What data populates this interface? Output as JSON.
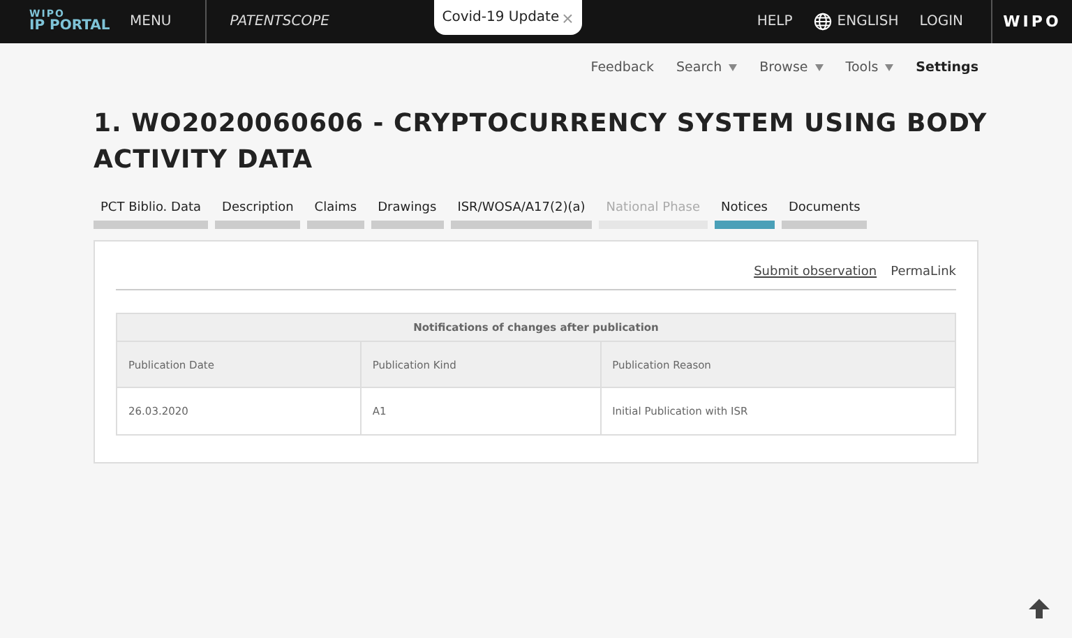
{
  "header": {
    "logo_small": "WIPO",
    "logo_large": "IP PORTAL",
    "menu": "MENU",
    "product": "PATENTSCOPE",
    "banner": {
      "label": "Covid-19 Update",
      "close": "×"
    },
    "links": [
      "HELP",
      "ENGLISH",
      "LOGIN"
    ],
    "brand": "WIPO"
  },
  "subnav": [
    {
      "label": "Feedback",
      "dropdown": false,
      "bold": false
    },
    {
      "label": "Search",
      "dropdown": true,
      "bold": false
    },
    {
      "label": "Browse",
      "dropdown": true,
      "bold": false
    },
    {
      "label": "Tools",
      "dropdown": true,
      "bold": false
    },
    {
      "label": "Settings",
      "dropdown": false,
      "bold": true
    }
  ],
  "title": "1. WO2020060606 - CRYPTOCURRENCY SYSTEM USING BODY ACTIVITY DATA",
  "tabs": [
    {
      "label": "PCT Biblio. Data",
      "selected": false,
      "disabled": false
    },
    {
      "label": "Description",
      "selected": false,
      "disabled": false
    },
    {
      "label": "Claims",
      "selected": false,
      "disabled": false
    },
    {
      "label": "Drawings",
      "selected": false,
      "disabled": false
    },
    {
      "label": "ISR/WOSA/A17(2)(a)",
      "selected": false,
      "disabled": false
    },
    {
      "label": "National Phase",
      "selected": false,
      "disabled": true
    },
    {
      "label": "Notices",
      "selected": true,
      "disabled": false
    },
    {
      "label": "Documents",
      "selected": false,
      "disabled": false
    }
  ],
  "panel_links": [
    "Submit observation",
    "PermaLink"
  ],
  "table": {
    "caption": "Notifications of changes after publication",
    "columns": [
      "Publication Date",
      "Publication Kind",
      "Publication Reason"
    ],
    "rows": [
      [
        "26.03.2020",
        "A1",
        "Initial Publication with ISR"
      ]
    ]
  }
}
